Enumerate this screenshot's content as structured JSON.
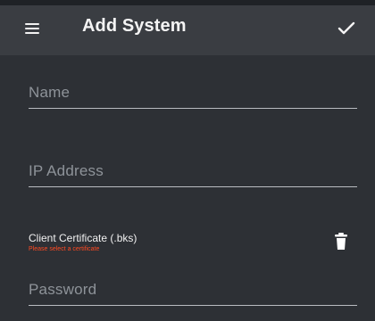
{
  "appbar": {
    "title": "Add System",
    "menu_icon": "menu-icon",
    "save_icon": "check-icon"
  },
  "form": {
    "name": {
      "placeholder": "Name"
    },
    "ip_address": {
      "placeholder": "IP Address"
    },
    "client_certificate": {
      "label": "Client Certificate (.bks)",
      "error": "Please select a certificate",
      "delete_icon": "trash-icon"
    },
    "password": {
      "placeholder": "Password"
    }
  },
  "colors": {
    "appbar_bg": "#3a3d42",
    "screen_bg": "#2d3035",
    "error": "#ff4a22",
    "text": "#f4f4f4",
    "hint": "#8e9399",
    "underline": "#b9bcc1"
  }
}
